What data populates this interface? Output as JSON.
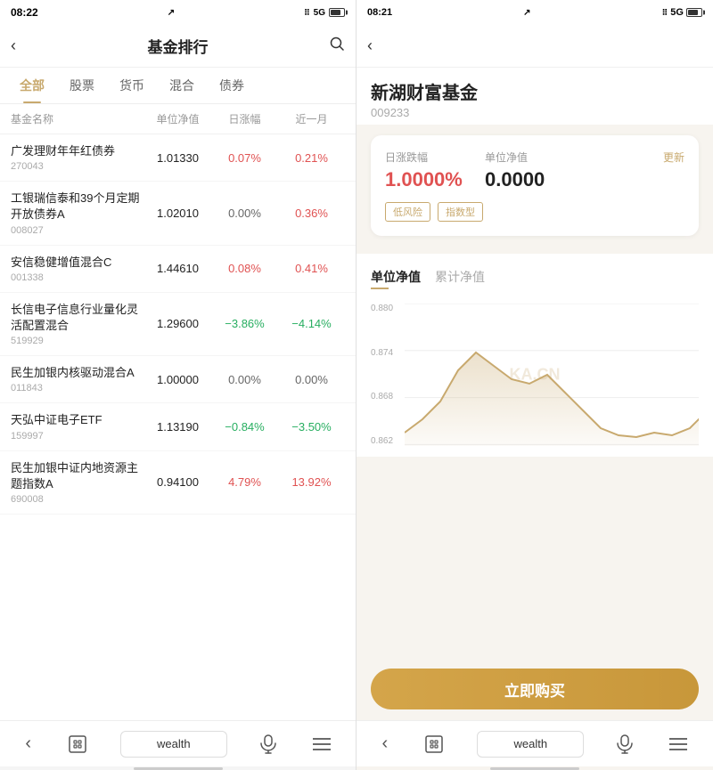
{
  "left": {
    "status": {
      "time": "08:22",
      "signal": "5G"
    },
    "header": {
      "title": "基金排行",
      "back_label": "‹",
      "search_label": "🔍"
    },
    "tabs": [
      {
        "label": "全部",
        "active": true
      },
      {
        "label": "股票",
        "active": false
      },
      {
        "label": "货币",
        "active": false
      },
      {
        "label": "混合",
        "active": false
      },
      {
        "label": "债券",
        "active": false
      }
    ],
    "table_headers": [
      "基金名称",
      "单位净值",
      "日涨幅",
      "近一月"
    ],
    "funds": [
      {
        "name": "广发理财年年红债券",
        "code": "270043",
        "nav": "1.01330",
        "change": "0.07%",
        "month": "0.21%",
        "change_color": "red",
        "month_color": "red"
      },
      {
        "name": "工银瑞信泰和39个月定期开放债券A",
        "code": "008027",
        "nav": "1.02010",
        "change": "0.00%",
        "month": "0.36%",
        "change_color": "gray",
        "month_color": "red"
      },
      {
        "name": "安信稳健增值混合C",
        "code": "001338",
        "nav": "1.44610",
        "change": "0.08%",
        "month": "0.41%",
        "change_color": "red",
        "month_color": "red"
      },
      {
        "name": "长信电子信息行业量化灵活配置混合",
        "code": "519929",
        "nav": "1.29600",
        "change": "−3.86%",
        "month": "−4.14%",
        "change_color": "green",
        "month_color": "green"
      },
      {
        "name": "民生加银内核驱动混合A",
        "code": "011843",
        "nav": "1.00000",
        "change": "0.00%",
        "month": "0.00%",
        "change_color": "gray",
        "month_color": "gray"
      },
      {
        "name": "天弘中证电子ETF",
        "code": "159997",
        "nav": "1.13190",
        "change": "−0.84%",
        "month": "−3.50%",
        "change_color": "green",
        "month_color": "green"
      },
      {
        "name": "民生加银中证内地资源主题指数A",
        "code": "690008",
        "nav": "0.94100",
        "change": "4.79%",
        "month": "13.92%",
        "change_color": "red",
        "month_color": "red"
      }
    ],
    "bottom_nav": {
      "back": "‹",
      "home": "⊡",
      "search_label": "wealth",
      "mic": "🎤",
      "menu": "≡"
    }
  },
  "right": {
    "status": {
      "time": "08:21",
      "signal": "5G"
    },
    "header": {
      "back_label": "‹"
    },
    "fund": {
      "name": "新湖财富基金",
      "code": "009233",
      "change_label": "日涨跌幅",
      "change_value": "1.0000%",
      "nav_label": "单位净值",
      "nav_value": "0.0000",
      "update_label": "更新",
      "tags": [
        "低风险",
        "指数型"
      ]
    },
    "chart": {
      "tab1": "单位净值",
      "tab2": "累计净值",
      "y_labels": [
        "0.880",
        "0.874",
        "0.868",
        "0.862"
      ],
      "watermark": "KA.CN"
    },
    "buy_btn": "立即购买",
    "bottom_nav": {
      "back": "‹",
      "home": "⊡",
      "search_label": "wealth",
      "mic": "🎤",
      "menu": "≡"
    }
  }
}
